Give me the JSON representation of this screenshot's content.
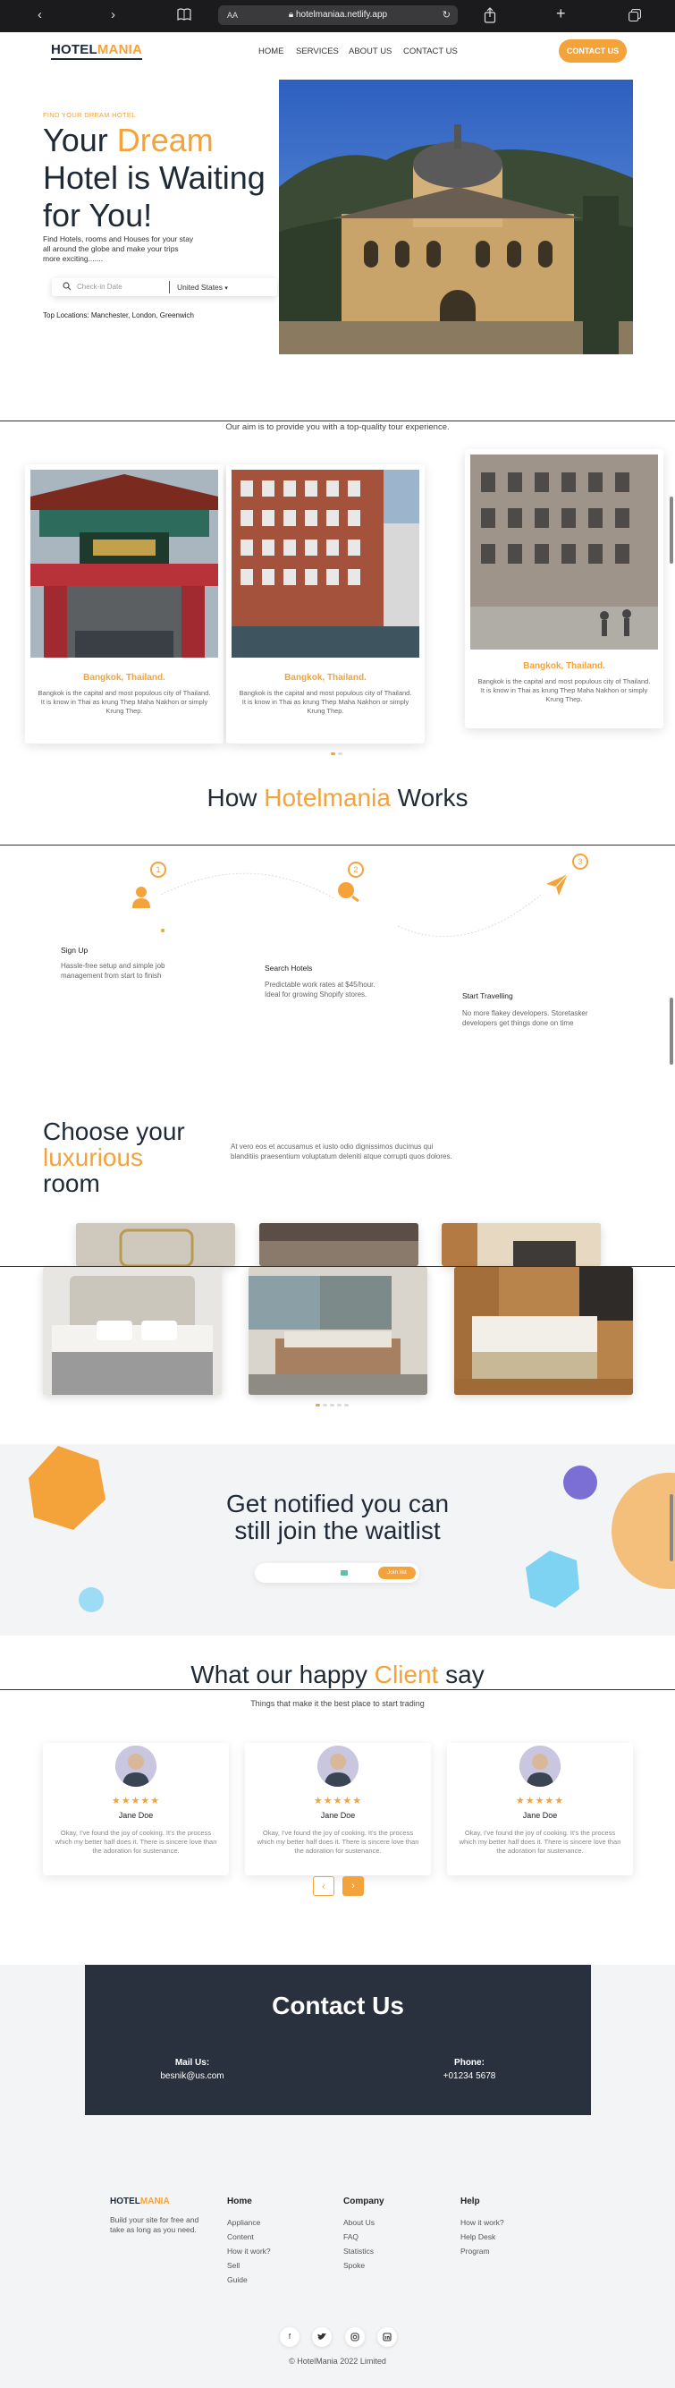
{
  "browser": {
    "text_size": "AA",
    "url": "hotelmaniaa.netlify.app"
  },
  "nav": {
    "logo_a": "HOTEL",
    "logo_b": "MANIA",
    "links": [
      "HOME",
      "SERVICES",
      "ABOUT US",
      "CONTACT US"
    ],
    "cta": "CONTACT US"
  },
  "hero": {
    "eyebrow": "FIND YOUR DREAM HOTEL",
    "title_1": "Your ",
    "title_highlight": "Dream",
    "title_2": "Hotel is Waiting for You!",
    "description": "Find Hotels, rooms and Houses for your stay all around the globe and make your trips more exciting.......",
    "search_placeholder": "Check-in Date",
    "country": "United States",
    "top_locations": "Top Locations: Manchester, London, Greenwich"
  },
  "aim": "Our aim is to provide you with a top-quality tour experience.",
  "destinations": [
    {
      "name": "Bangkok, Thailand.",
      "desc": "Bangkok is the capital and most populous city of Thailand. It is know in Thai as krung Thep Maha Nakhon or simply Krung Thep."
    },
    {
      "name": "Bangkok, Thailand.",
      "desc": "Bangkok is the capital and most populous city of Thailand. It is know in Thai as krung Thep Maha Nakhon or simply Krung Thep."
    },
    {
      "name": "Bangkok, Thailand.",
      "desc": "Bangkok is the capital and most populous city of Thailand. It is know in Thai as krung Thep Maha Nakhon or simply Krung Thep."
    }
  ],
  "how": {
    "title_1": "How ",
    "title_highlight": "Hotelmania",
    "title_2": " Works",
    "steps": [
      {
        "num": "1",
        "title": "Sign Up",
        "desc": "Hassle-free setup and simple job management from start to finish"
      },
      {
        "num": "2",
        "title": "Search Hotels",
        "desc": "Predictable work rates at $45/hour. Ideal for growing Shopify stores."
      },
      {
        "num": "3",
        "title": "Start Travelling",
        "desc": "No more flakey developers. Storetasker developers get things done on time"
      }
    ]
  },
  "luxury": {
    "title_1": "Choose your",
    "title_highlight": "luxurious",
    "title_2": "room",
    "desc": "At vero eos et accusamus et iusto odio dignissimos ducimus qui blanditiis praesentium voluptatum deleniti atque corrupti quos dolores."
  },
  "waitlist": {
    "title": "Get notified you can still join the waitlist",
    "button": "Join list"
  },
  "testimonials": {
    "title_1": "What our happy ",
    "title_highlight": "Client",
    "title_2": " say",
    "subtitle": "Things that make it the best place to start trading",
    "stars": "★★★★★",
    "items": [
      {
        "name": "Jane Doe",
        "text": "Okay, I've found the joy of cooking. It's the process which my better half does it. There is sincere love than the adoration for sustenance."
      },
      {
        "name": "Jane Doe",
        "text": "Okay, I've found the joy of cooking. It's the process which my better half does it. There is sincere love than the adoration for sustenance."
      },
      {
        "name": "Jane Doe",
        "text": "Okay, I've found the joy of cooking. It's the process which my better half does it. There is sincere love than the adoration for sustenance."
      }
    ],
    "prev": "‹",
    "next": "›"
  },
  "contact": {
    "title": "Contact Us",
    "mail_label": "Mail Us:",
    "mail": "besnik@us.com",
    "phone_label": "Phone:",
    "phone": "+01234 5678"
  },
  "footer": {
    "logo_a": "HOTEL",
    "logo_b": "MANIA",
    "tagline": "Build your site for free and take as long as you need.",
    "columns": [
      {
        "head": "Home",
        "links": [
          "Appliance",
          "Content",
          "How it work?",
          "Sell",
          "Guide"
        ]
      },
      {
        "head": "Company",
        "links": [
          "About Us",
          "FAQ",
          "Statistics",
          "Spoke"
        ]
      },
      {
        "head": "Help",
        "links": [
          "How it work?",
          "Help Desk",
          "Program"
        ]
      }
    ],
    "copyright": "© HotelMania 2022 Limited"
  },
  "colors": {
    "accent": "#f4a23a",
    "dark": "#28313d",
    "light_blue": "#7fd3f2",
    "purple": "#7b6fd6"
  }
}
